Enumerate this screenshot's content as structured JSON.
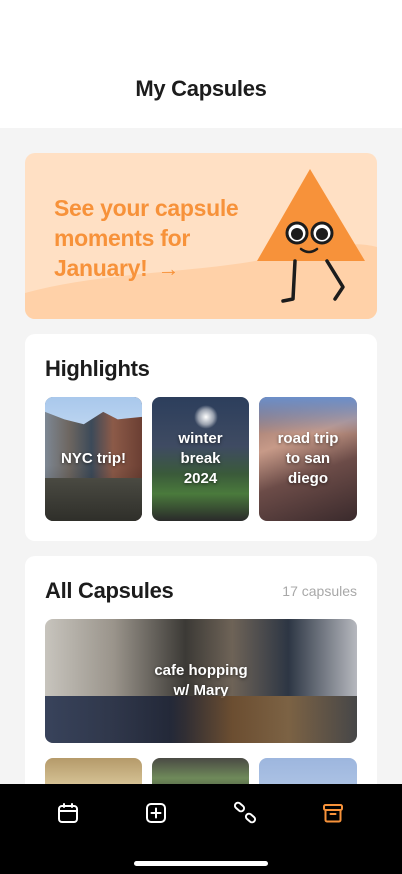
{
  "header": {
    "title": "My Capsules"
  },
  "banner": {
    "line1": "See your capsule",
    "line2": "moments for",
    "line3": "January!",
    "arrow": "→"
  },
  "highlights": {
    "title": "Highlights",
    "items": [
      {
        "label_line1": "NYC trip!",
        "label_line2": "",
        "label_line3": ""
      },
      {
        "label_line1": "winter",
        "label_line2": "break",
        "label_line3": "2024"
      },
      {
        "label_line1": "road trip",
        "label_line2": "to san",
        "label_line3": "diego"
      }
    ]
  },
  "all_capsules": {
    "title": "All Capsules",
    "count": "17 capsules",
    "featured": {
      "label_line1": "cafe hopping",
      "label_line2": "w/ Mary"
    }
  },
  "nav": {
    "items": [
      {
        "icon": "calendar-icon",
        "active": false
      },
      {
        "icon": "plus-square-icon",
        "active": false
      },
      {
        "icon": "pills-icon",
        "active": false
      },
      {
        "icon": "archive-icon",
        "active": true
      }
    ],
    "active_color": "#f7923a",
    "inactive_color": "#ffffff"
  },
  "colors": {
    "accent": "#f7923a",
    "banner_bg": "#ffe0c4",
    "page_bg": "#f4f4f4"
  }
}
